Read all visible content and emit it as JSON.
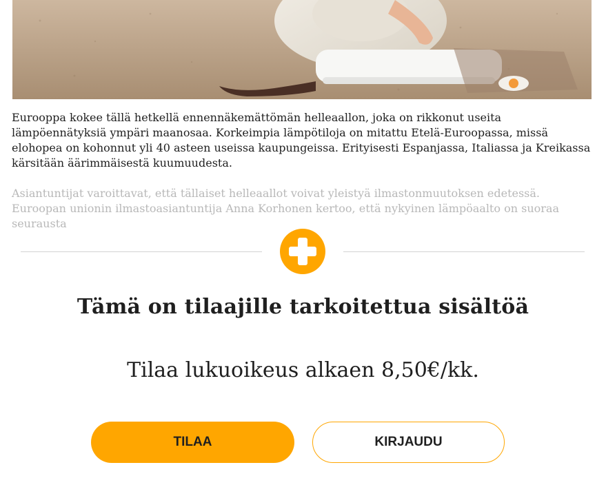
{
  "hero_image": {
    "alt_semantic": "woman-in-sunhat-on-beach-photo"
  },
  "article": {
    "paragraph_1": "Eurooppa kokee tällä hetkellä ennennäkemättömän helleaallon, joka on rikkonut useita lämpöennätyksiä ympäri maanosaa. Korkeimpia lämpötiloja on mitattu Etelä-Euroopassa, missä elohopea on kohonnut yli 40 asteen useissa kaupungeissa. Erityisesti Espanjassa, Italiassa ja Kreikassa kärsitään äärimmäisestä kuumuudesta.",
    "paragraph_2": "Asiantuntijat varoittavat, että tällaiset helleaallot voivat yleistyä ilmastonmuutoksen edetessä. Euroopan unionin ilmastoasiantuntija Anna Korhonen kertoo, että nykyinen lämpöaalto on suoraa seurausta"
  },
  "paywall": {
    "icon": "plus-icon",
    "title": "Tämä on tilaajille tarkoitettua sisältöä",
    "offer": "Tilaa lukuoikeus alkaen 8,50€/kk.",
    "subscribe_label": "TILAA",
    "login_label": "KIRJAUDU"
  },
  "colors": {
    "accent": "#ffa600",
    "text": "#1f1f1f",
    "faded_text": "#b8b8b8",
    "divider": "#d2d2d2"
  }
}
